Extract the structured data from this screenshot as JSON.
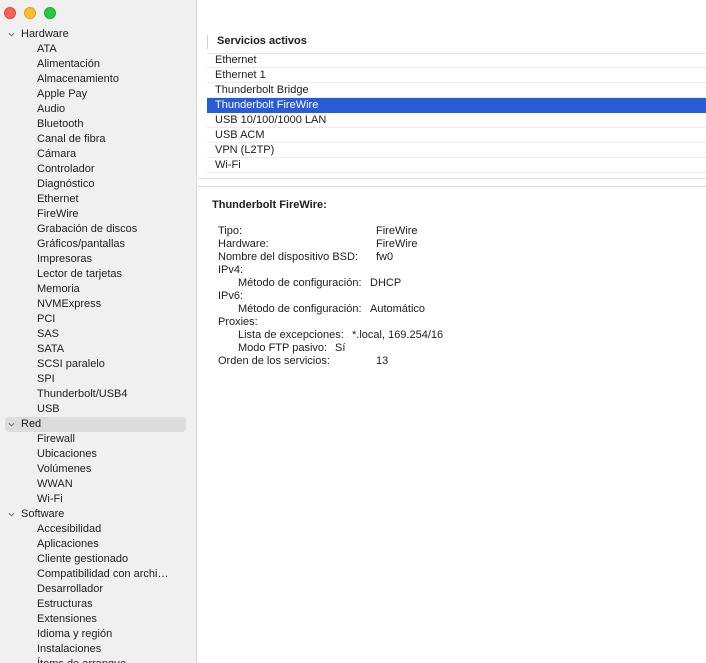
{
  "window": {
    "buttons": [
      "close",
      "minimize",
      "zoom"
    ]
  },
  "sidebar": {
    "groups": [
      {
        "label": "Hardware",
        "expanded": true,
        "items": [
          "ATA",
          "Alimentación",
          "Almacenamiento",
          "Apple Pay",
          "Audio",
          "Bluetooth",
          "Canal de fibra",
          "Cámara",
          "Controlador",
          "Diagnóstico",
          "Ethernet",
          "FireWire",
          "Grabación de discos",
          "Gráficos/pantallas",
          "Impresoras",
          "Lector de tarjetas",
          "Memoria",
          "NVMExpress",
          "PCI",
          "SAS",
          "SATA",
          "SCSI paralelo",
          "SPI",
          "Thunderbolt/USB4",
          "USB"
        ]
      },
      {
        "label": "Red",
        "expanded": true,
        "selected": true,
        "items": [
          "Firewall",
          "Ubicaciones",
          "Volúmenes",
          "WWAN",
          "Wi-Fi"
        ]
      },
      {
        "label": "Software",
        "expanded": true,
        "items": [
          "Accesibilidad",
          "Aplicaciones",
          "Cliente gestionado",
          "Compatibilidad con archi…",
          "Desarrollador",
          "Estructuras",
          "Extensiones",
          "Idioma y región",
          "Instalaciones",
          "Ítems de arranque"
        ]
      }
    ]
  },
  "services_table": {
    "header": "Servicios activos",
    "rows": [
      "Ethernet",
      "Ethernet 1",
      "Thunderbolt Bridge",
      "Thunderbolt FireWire",
      "USB 10/100/1000 LAN",
      "USB ACM",
      "VPN (L2TP)",
      "Wi-Fi"
    ],
    "selected_index": 3
  },
  "detail": {
    "title": "Thunderbolt FireWire:",
    "properties": [
      {
        "key": "Tipo:",
        "value": "FireWire",
        "indent": 0
      },
      {
        "key": "Hardware:",
        "value": "FireWire",
        "indent": 0
      },
      {
        "key": "Nombre del dispositivo BSD:",
        "value": "fw0",
        "indent": 0
      },
      {
        "key": "IPv4:",
        "value": "",
        "indent": 0
      },
      {
        "key": "Método de configuración:",
        "value": "DHCP",
        "indent": 1
      },
      {
        "key": "IPv6:",
        "value": "",
        "indent": 0
      },
      {
        "key": "Método de configuración:",
        "value": "Automático",
        "indent": 1
      },
      {
        "key": "Proxies:",
        "value": "",
        "indent": 0
      },
      {
        "key": "Lista de excepciones:",
        "value": "*.local, 169.254/16",
        "indent": 1
      },
      {
        "key": "Modo FTP pasivo:",
        "value": "Sí",
        "indent": 1
      },
      {
        "key": "Orden de los servicios:",
        "value": "13",
        "indent": 0
      }
    ]
  },
  "colors": {
    "selection": "#2a5bd7",
    "sidebar_bg": "#f0f0f0",
    "sidebar_selected": "#dcdcdc"
  }
}
